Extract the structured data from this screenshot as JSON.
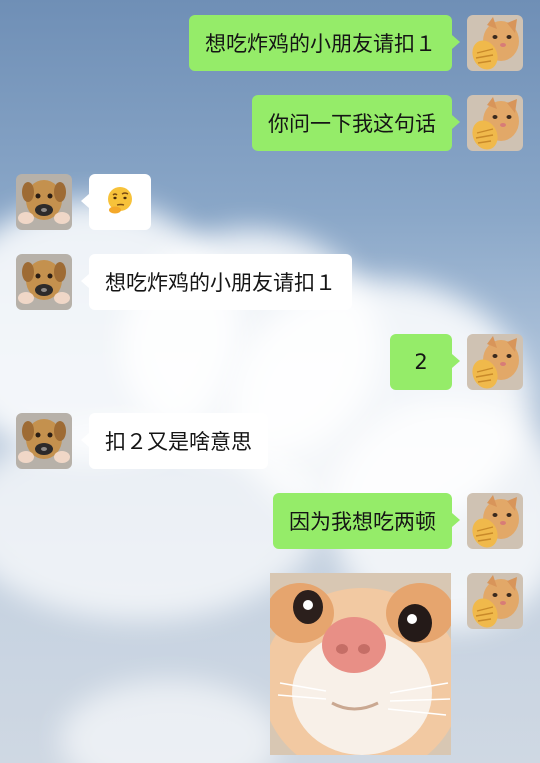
{
  "chat": {
    "messages": [
      {
        "side": "right",
        "type": "text",
        "text": "想吃炸鸡的小朋友请扣１"
      },
      {
        "side": "right",
        "type": "text",
        "text": "你问一下我这句话"
      },
      {
        "side": "left",
        "type": "sticker",
        "sticker": "thinking-face-emoji"
      },
      {
        "side": "left",
        "type": "text",
        "text": "想吃炸鸡的小朋友请扣１"
      },
      {
        "side": "right",
        "type": "text",
        "text": "2"
      },
      {
        "side": "left",
        "type": "text",
        "text": "扣２又是啥意思"
      },
      {
        "side": "right",
        "type": "text",
        "text": "因为我想吃两顿"
      },
      {
        "side": "right",
        "type": "image",
        "image": "cat-closeup-photo"
      }
    ]
  },
  "avatars": {
    "self": "cat-eating-snack-avatar",
    "other": "puppy-avatar"
  },
  "colors": {
    "outgoing_bubble": "#95ec69",
    "incoming_bubble": "#ffffff",
    "background": "sky-with-clouds"
  }
}
